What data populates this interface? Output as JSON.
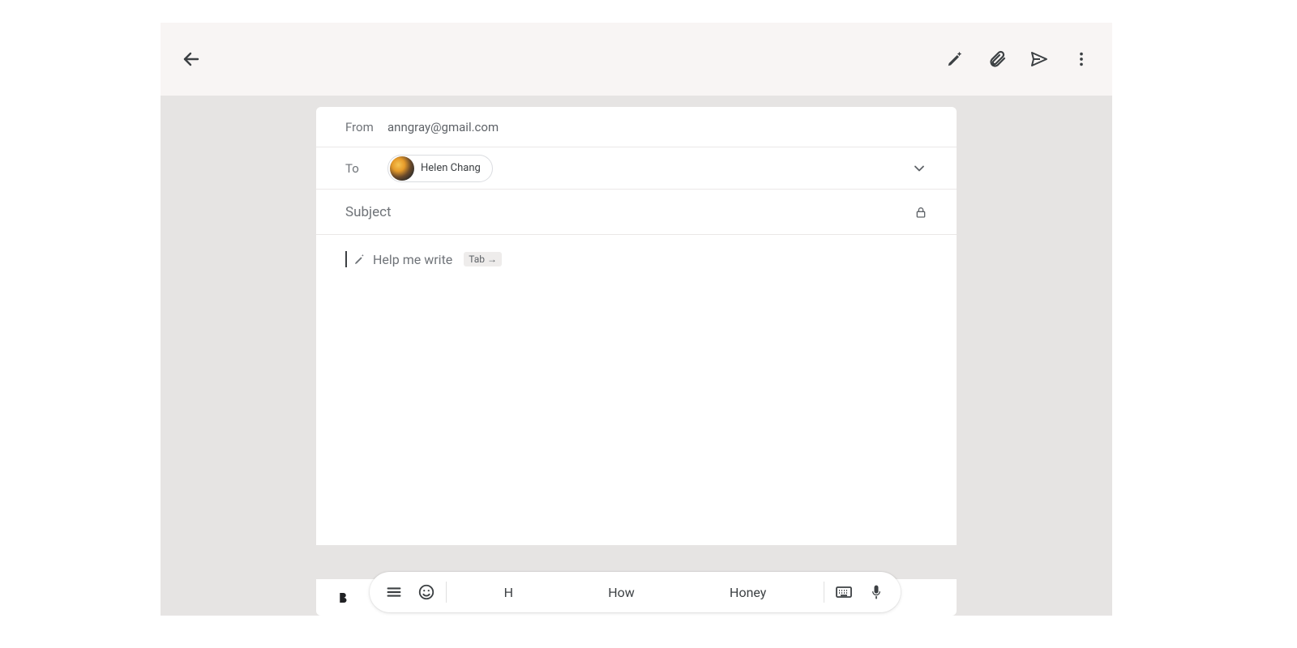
{
  "from": {
    "label": "From",
    "email": "anngray@gmail.com"
  },
  "to": {
    "label": "To",
    "recipients": [
      {
        "name": "Helen Chang"
      }
    ]
  },
  "subject": {
    "placeholder": "Subject"
  },
  "body": {
    "help_me_write_label": "Help me write",
    "tab_hint_label": "Tab",
    "tab_hint_arrow": "→"
  },
  "keyboard": {
    "suggestions": [
      "H",
      "How",
      "Honey"
    ]
  }
}
